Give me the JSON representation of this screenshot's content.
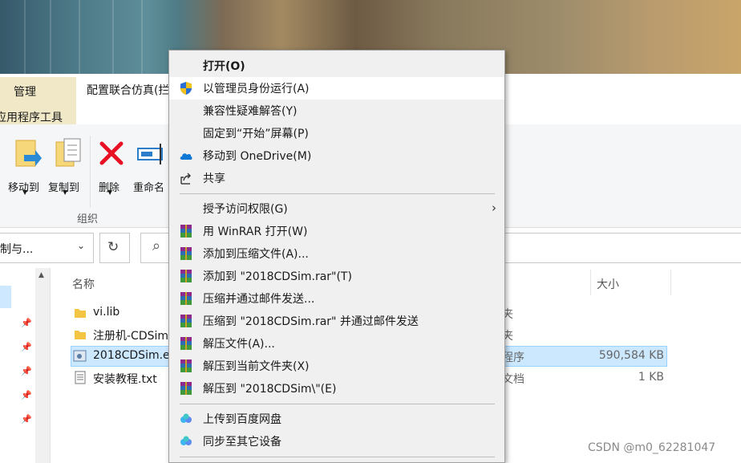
{
  "ribbon": {
    "tab_manage": "管理",
    "tab_title": "配置联合仿真(拦",
    "tab_app_tools": "应用程序工具",
    "buttons": {
      "move_to": "移动到",
      "copy_to": "复制到",
      "delete": "删除",
      "rename": "重命名"
    },
    "group_label": "组织"
  },
  "address": {
    "path": "制与...",
    "chevron": "⌄",
    "refresh": "↻",
    "search_icon": "⌕"
  },
  "columns": {
    "name": "名称",
    "size": "大小"
  },
  "files": [
    {
      "name": "vi.lib",
      "type": "夹",
      "size": "",
      "icon": "folder-icon"
    },
    {
      "name": "注册机-CDSim",
      "type": "夹",
      "size": "",
      "icon": "folder-icon"
    },
    {
      "name": "2018CDSim.e",
      "type": "程序",
      "size": "590,584 KB",
      "icon": "exe-icon",
      "selected": true
    },
    {
      "name": "安装教程.txt",
      "type": "文档",
      "size": "1 KB",
      "icon": "text-file-icon"
    }
  ],
  "context_menu": {
    "items": [
      {
        "label": "打开(O)",
        "bold": true
      },
      {
        "label": "以管理员身份运行(A)",
        "icon": "uac-shield-icon",
        "highlighted": true
      },
      {
        "label": "兼容性疑难解答(Y)"
      },
      {
        "label": "固定到“开始”屏幕(P)"
      },
      {
        "label": "移动到 OneDrive(M)",
        "icon": "onedrive-cloud-icon"
      },
      {
        "label": "共享",
        "icon": "share-icon"
      },
      {
        "label": "授予访问权限(G)",
        "submenu": true
      },
      {
        "label": "用 WinRAR 打开(W)",
        "icon": "winrar-icon"
      },
      {
        "label": "添加到压缩文件(A)...",
        "icon": "winrar-icon"
      },
      {
        "label": "添加到 \"2018CDSim.rar\"(T)",
        "icon": "winrar-icon"
      },
      {
        "label": "压缩并通过邮件发送...",
        "icon": "winrar-icon"
      },
      {
        "label": "压缩到 \"2018CDSim.rar\" 并通过邮件发送",
        "icon": "winrar-icon"
      },
      {
        "label": "解压文件(A)...",
        "icon": "winrar-icon"
      },
      {
        "label": "解压到当前文件夹(X)",
        "icon": "winrar-icon"
      },
      {
        "label": "解压到 \"2018CDSim\\\"(E)",
        "icon": "winrar-icon"
      },
      {
        "label": "上传到百度网盘",
        "icon": "baidu-netdisk-icon"
      },
      {
        "label": "同步至其它设备",
        "icon": "baidu-netdisk-icon"
      }
    ],
    "submenu_arrow": "›"
  },
  "watermark": "CSDN @m0_62281047",
  "colors": {
    "selection": "#cce8ff",
    "ribbon_tab": "#f1e8c7",
    "menu_bg": "#f0f0f0",
    "delete_red": "#e81123"
  }
}
